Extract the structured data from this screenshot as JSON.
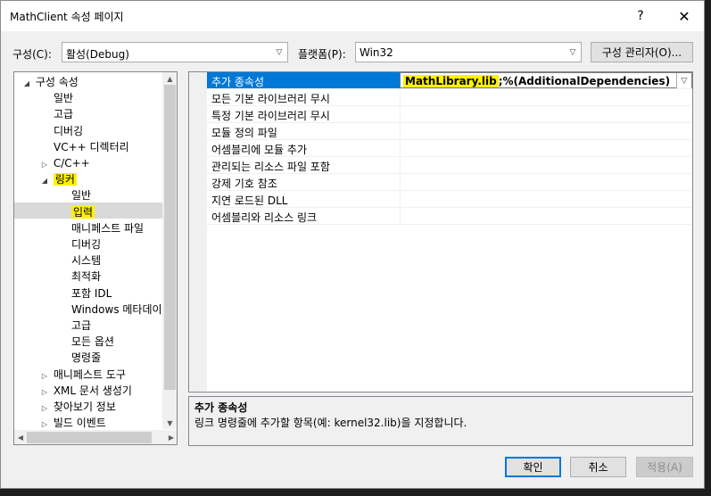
{
  "window": {
    "title": "MathClient 속성 페이지",
    "help": "?",
    "close": "✕"
  },
  "config": {
    "label": "구성(C):",
    "value": "활성(Debug)"
  },
  "platform": {
    "label": "플랫폼(P):",
    "value": "Win32"
  },
  "config_manager_label": "구성 관리자(O)...",
  "tree": {
    "items": [
      {
        "label": "구성 속성",
        "expander": "◢"
      },
      {
        "label": "일반"
      },
      {
        "label": "고급"
      },
      {
        "label": "디버깅"
      },
      {
        "label": "VC++ 디렉터리"
      },
      {
        "label": "C/C++",
        "expander": "▷"
      },
      {
        "label": "링커",
        "expander": "◢",
        "highlight": true
      },
      {
        "label": "일반"
      },
      {
        "label": "입력",
        "selected": true,
        "highlight": true
      },
      {
        "label": "매니페스트 파일"
      },
      {
        "label": "디버깅"
      },
      {
        "label": "시스템"
      },
      {
        "label": "최적화"
      },
      {
        "label": "포함 IDL"
      },
      {
        "label": "Windows 메타데이"
      },
      {
        "label": "고급"
      },
      {
        "label": "모든 옵션"
      },
      {
        "label": "명령줄"
      },
      {
        "label": "매니페스트 도구",
        "expander": "▷"
      },
      {
        "label": "XML 문서 생성기",
        "expander": "▷"
      },
      {
        "label": "찾아보기 정보",
        "expander": "▷"
      },
      {
        "label": "빌드 이벤트",
        "expander": "▷"
      }
    ]
  },
  "properties": {
    "rows": [
      {
        "name": "추가 종속성",
        "value_highlight": "MathLibrary.lib",
        "value_rest": ";%(AdditionalDependencies)"
      },
      {
        "name": "모든 기본 라이브러리 무시"
      },
      {
        "name": "특정 기본 라이브러리 무시"
      },
      {
        "name": "모듈 정의 파일"
      },
      {
        "name": "어셈블리에 모듈 추가"
      },
      {
        "name": "관리되는 리소스 파일 포함"
      },
      {
        "name": "강제 기호 참조"
      },
      {
        "name": "지연 로드된 DLL"
      },
      {
        "name": "어셈블리와 리소스 링크"
      }
    ]
  },
  "description": {
    "title": "추가 종속성",
    "text": "링크 명령줄에 추가할 항목(예: kernel32.lib)을 지정합니다."
  },
  "buttons": {
    "ok": "확인",
    "cancel": "취소",
    "apply": "적용(A)"
  },
  "colors": {
    "selection": "#0078d7",
    "highlight": "#fff200"
  }
}
